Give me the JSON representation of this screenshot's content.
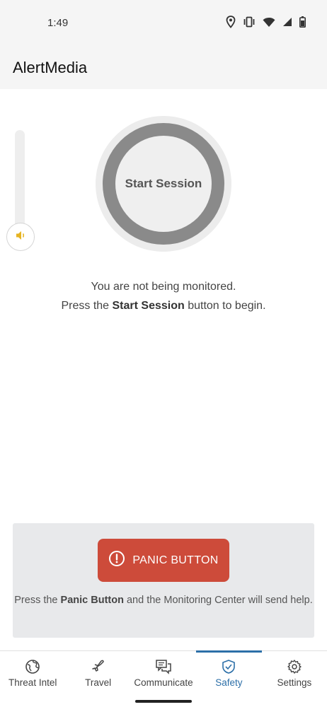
{
  "status_bar": {
    "time": "1:49",
    "icons": [
      "location-icon",
      "vibrate-icon",
      "wifi-icon",
      "signal-icon",
      "battery-icon"
    ]
  },
  "app_bar": {
    "title": "AlertMedia"
  },
  "volume": {
    "icon": "speaker-icon",
    "accent": "#e6b422"
  },
  "session": {
    "button_label": "Start Session"
  },
  "monitor": {
    "line1": "You are not being monitored.",
    "line2_prefix": "Press the ",
    "line2_bold": "Start Session",
    "line2_suffix": " button to begin."
  },
  "panic": {
    "button_label": "PANIC BUTTON",
    "icon": "alert-circle-icon",
    "help_prefix": "Press the ",
    "help_bold": "Panic Button",
    "help_suffix": " and the Monitoring Center will send help.",
    "color": "#cd4b3a"
  },
  "nav": {
    "items": [
      {
        "label": "Threat Intel",
        "icon": "globe-icon",
        "active": false
      },
      {
        "label": "Travel",
        "icon": "plane-icon",
        "active": false
      },
      {
        "label": "Communicate",
        "icon": "chat-icon",
        "active": false
      },
      {
        "label": "Safety",
        "icon": "shield-check-icon",
        "active": true
      },
      {
        "label": "Settings",
        "icon": "gear-icon",
        "active": false
      }
    ],
    "active_color": "#2c6fa8"
  }
}
